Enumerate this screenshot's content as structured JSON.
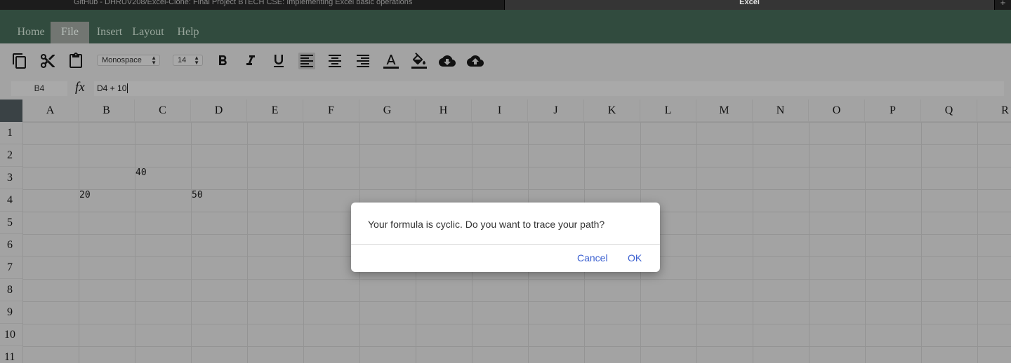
{
  "browser": {
    "tabs": [
      {
        "title": "GitHub - DHRUV208/Excel-Clone: Final Project BTECH CSE: Implementing Excel basic operations"
      },
      {
        "title": "Excel"
      }
    ],
    "new_tab_glyph": "+"
  },
  "menu": {
    "items": [
      {
        "label": "Home"
      },
      {
        "label": "File"
      },
      {
        "label": "Insert"
      },
      {
        "label": "Layout"
      },
      {
        "label": "Help"
      }
    ],
    "active": "File"
  },
  "toolbar": {
    "font_family": "Monospace",
    "font_size": "14",
    "bold": "B",
    "italic": "I",
    "underline": "U",
    "active_alignment": "left",
    "icons": [
      "copy-icon",
      "cut-icon",
      "paste-icon",
      "bold-icon",
      "italic-icon",
      "underline-icon",
      "align-left-icon",
      "align-center-icon",
      "align-right-icon",
      "text-color-icon",
      "fill-color-icon",
      "download-icon",
      "upload-icon"
    ]
  },
  "formula_bar": {
    "cell_ref": "B4",
    "fx_label": "fx",
    "formula": "D4 + 10"
  },
  "grid": {
    "columns": [
      "A",
      "B",
      "C",
      "D",
      "E",
      "F",
      "G",
      "H",
      "I",
      "J",
      "K",
      "L",
      "M",
      "N",
      "O",
      "P",
      "Q",
      "R"
    ],
    "rows": [
      "1",
      "2",
      "3",
      "4",
      "5",
      "6",
      "7",
      "8",
      "9",
      "10",
      "11"
    ],
    "cells": {
      "C3": "40",
      "B4": "20",
      "D4": "50"
    }
  },
  "dialog": {
    "message": "Your formula is cyclic. Do you want to trace your path?",
    "cancel_label": "Cancel",
    "ok_label": "OK"
  },
  "colors": {
    "menubar": "#314b3e",
    "dialog_button": "#3a5fd0",
    "corner": "#3a4245"
  }
}
